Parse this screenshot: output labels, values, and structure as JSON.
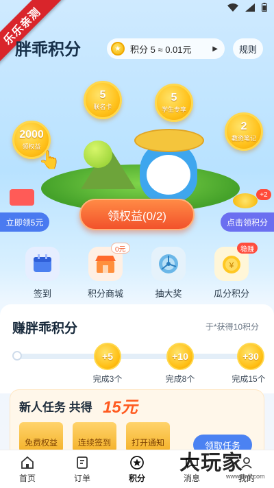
{
  "status": {
    "battery": "▮"
  },
  "ribbon": "乐乐亲测",
  "header": {
    "title": "胖乖积分",
    "points_text": "积分 5 ≈ 0.01元",
    "rules_label": "规则"
  },
  "float_coins": [
    {
      "value": "5",
      "label": "联名卡"
    },
    {
      "value": "5",
      "label": "学生专享"
    },
    {
      "value": "2000",
      "label": "领权益"
    },
    {
      "value": "2",
      "label": "教资笔记"
    }
  ],
  "claim_button": "领权益(0/2)",
  "side_left": "立即领5元",
  "side_right": "点击领积分",
  "side_right_badge": "+2",
  "quick": [
    {
      "label": "签到",
      "badge": ""
    },
    {
      "label": "积分商城",
      "badge": "0元"
    },
    {
      "label": "抽大奖",
      "badge": ""
    },
    {
      "label": "瓜分积分",
      "badge": "稳赚"
    }
  ],
  "earn": {
    "title": "赚胖乖积分",
    "subtitle": "于*获得10积分",
    "milestones": [
      {
        "reward": "+5",
        "label": "完成3个"
      },
      {
        "reward": "+10",
        "label": "完成8个"
      },
      {
        "reward": "+30",
        "label": "完成15个"
      }
    ]
  },
  "newbie": {
    "title": "新人任务 共得",
    "amount": "15元",
    "gifts": [
      "免费权益",
      "连续签到",
      "打开通知"
    ],
    "cta": "领取任务"
  },
  "nav": [
    {
      "label": "首页"
    },
    {
      "label": "订单"
    },
    {
      "label": "积分"
    },
    {
      "label": "消息"
    },
    {
      "label": "我的"
    }
  ],
  "watermark": "大玩家",
  "watermark_url": "www.dwjl.com",
  "colors": {
    "accent": "#f2522b",
    "blue": "#4b82f2",
    "coin": "#ffc21c"
  }
}
